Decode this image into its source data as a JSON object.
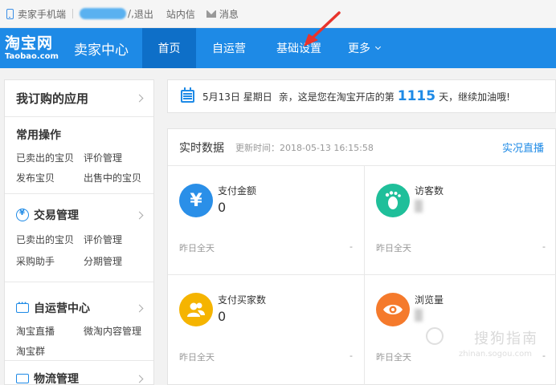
{
  "topbar": {
    "mobile_label": "卖家手机端",
    "logout": "退出",
    "station_mail": "站内信",
    "messages": "消息",
    "user_suffix": "/"
  },
  "nav": {
    "logo_cn": "淘宝网",
    "logo_en": "Taobao.com",
    "brand": "卖家中心",
    "items": [
      {
        "label": "首页"
      },
      {
        "label": "自运营"
      },
      {
        "label": "基础设置"
      },
      {
        "label": "更多"
      }
    ]
  },
  "sidebar": {
    "header": "我订购的应用",
    "common": {
      "title": "常用操作",
      "items": [
        "已卖出的宝贝",
        "评价管理",
        "发布宝贝",
        "出售中的宝贝"
      ]
    },
    "trade": {
      "title": "交易管理",
      "items": [
        "已卖出的宝贝",
        "评价管理",
        "采购助手",
        "分期管理"
      ]
    },
    "selfop": {
      "title": "自运营中心",
      "items": [
        "淘宝直播",
        "微淘内容管理",
        "淘宝群"
      ]
    },
    "logistics": {
      "title": "物流管理"
    }
  },
  "banner": {
    "date": "5月13日 星期日",
    "prefix": "亲，这是您在淘宝开店的第",
    "days": "1115",
    "suffix": "天，继续加油哦!"
  },
  "realtime": {
    "title": "实时数据",
    "update": "更新时间：2018-05-13 16:15:58",
    "live": "实况直播",
    "cards": [
      {
        "label": "支付金额",
        "value": "0",
        "footer_label": "昨日全天",
        "footer_value": "-",
        "icon": "yen-icon",
        "color": "#2a8fe8"
      },
      {
        "label": "访客数",
        "value": "",
        "footer_label": "昨日全天",
        "footer_value": "-",
        "icon": "footprint-icon",
        "color": "#1fbf9a"
      },
      {
        "label": "支付买家数",
        "value": "0",
        "footer_label": "昨日全天",
        "footer_value": "-",
        "icon": "users-icon",
        "color": "#f5b400"
      },
      {
        "label": "浏览量",
        "value": "",
        "footer_label": "昨日全天",
        "footer_value": "-",
        "icon": "eye-icon",
        "color": "#f57a2c"
      }
    ]
  },
  "watermark": {
    "text": "搜狗指南",
    "sub": "zhinan.sogou.com"
  }
}
